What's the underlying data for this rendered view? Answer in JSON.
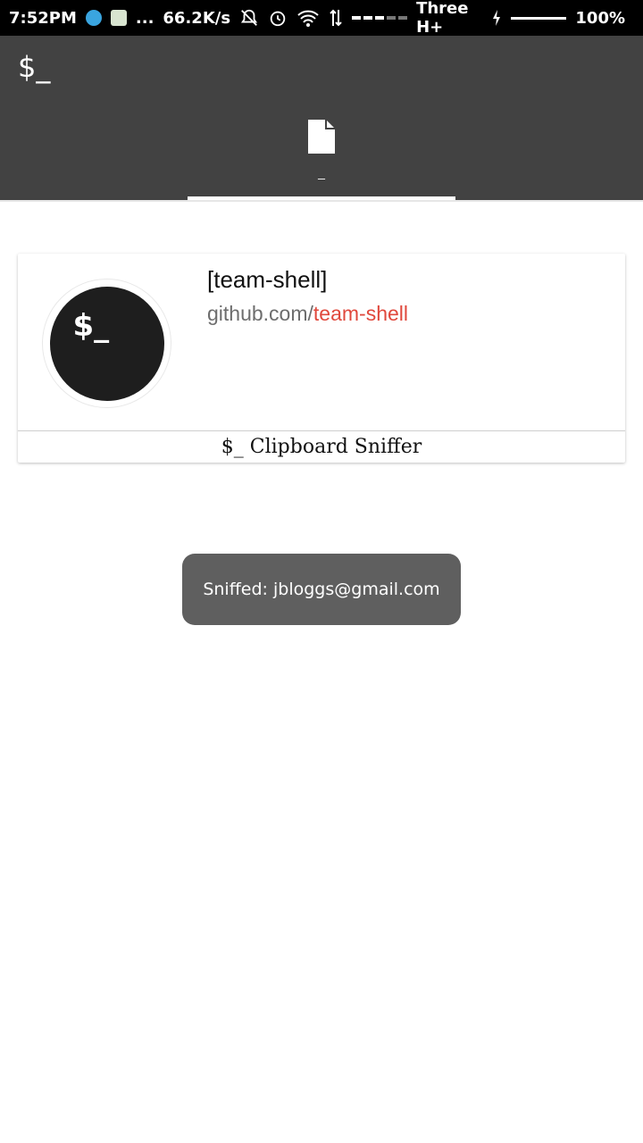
{
  "status_bar": {
    "time": "7:52PM",
    "more": "...",
    "speed": "66.2K/s",
    "carrier": "Three H+",
    "battery": "100%"
  },
  "app_bar": {
    "logo": "$_",
    "tab": {
      "label": "_",
      "icon": "file-icon"
    }
  },
  "card": {
    "avatar_text": "$_",
    "title": "[team-shell]",
    "link_prefix": "github.com/",
    "link_highlight": "team-shell",
    "footer": "$_ Clipboard Sniffer"
  },
  "toast": {
    "message": "Sniffed: jbloggs@gmail.com"
  },
  "colors": {
    "app_bar": "#424242",
    "accent": "#e0483c",
    "toast_bg": "#5f5f5f"
  }
}
